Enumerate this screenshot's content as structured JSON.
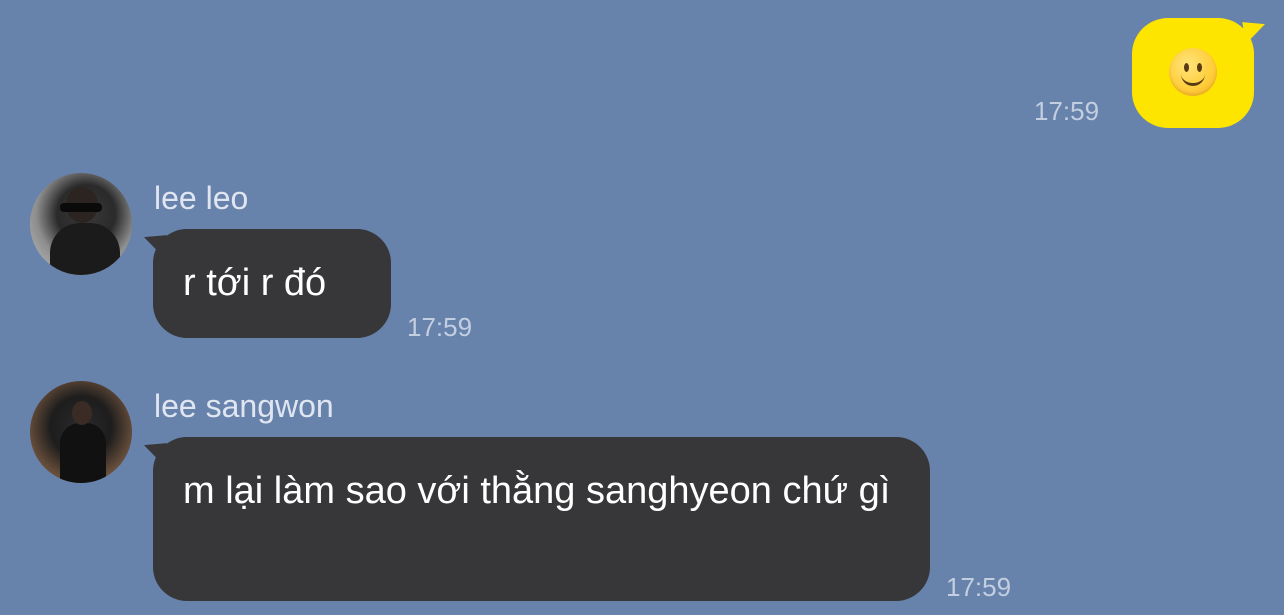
{
  "messages": [
    {
      "direction": "outgoing",
      "content": "slightly-smiling-face-emoji",
      "time": "17:59"
    },
    {
      "direction": "incoming",
      "sender": "lee leo",
      "text": "r tới r đó",
      "time": "17:59"
    },
    {
      "direction": "incoming",
      "sender": "lee sangwon",
      "text": "m lại làm sao với thằng sanghyeon chứ gì",
      "time": "17:59"
    }
  ],
  "colors": {
    "background": "#6883ab",
    "outgoing_bubble": "#fee500",
    "incoming_bubble": "#373739",
    "timestamp": "#c3cee0",
    "sender_name": "#dfe6f1"
  }
}
